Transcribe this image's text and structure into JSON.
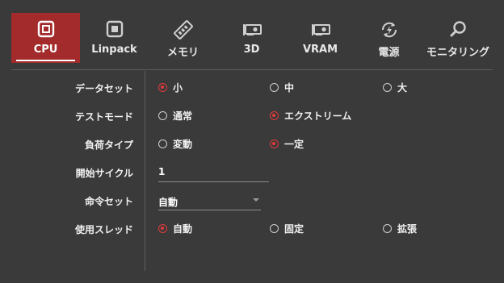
{
  "tabs": [
    {
      "label": "CPU",
      "icon": "cpu-icon",
      "active": true
    },
    {
      "label": "Linpack",
      "icon": "linpack-icon",
      "active": false
    },
    {
      "label": "メモリ",
      "icon": "memory-icon",
      "active": false
    },
    {
      "label": "3D",
      "icon": "gpu-3d-icon",
      "active": false
    },
    {
      "label": "VRAM",
      "icon": "vram-icon",
      "active": false
    },
    {
      "label": "電源",
      "icon": "power-icon",
      "active": false
    },
    {
      "label": "モニタリング",
      "icon": "monitoring-icon",
      "active": false
    }
  ],
  "settings": {
    "dataset": {
      "label": "データセット",
      "options": [
        "小",
        "中",
        "大"
      ],
      "selected": "小"
    },
    "test_mode": {
      "label": "テストモード",
      "options": [
        "通常",
        "エクストリーム"
      ],
      "selected": "エクストリーム"
    },
    "load_type": {
      "label": "負荷タイプ",
      "options": [
        "変動",
        "一定"
      ],
      "selected": "一定"
    },
    "start_cycle": {
      "label": "開始サイクル",
      "value": "1"
    },
    "instruction_set": {
      "label": "命令セット",
      "value": "自動"
    },
    "threads": {
      "label": "使用スレッド",
      "options": [
        "自動",
        "固定",
        "拡張"
      ],
      "selected": "自動"
    }
  },
  "colors": {
    "background": "#3a3a3a",
    "accent": "#a32b2b",
    "radio_selected": "#e03a3a",
    "divider": "#5e5e5e"
  }
}
